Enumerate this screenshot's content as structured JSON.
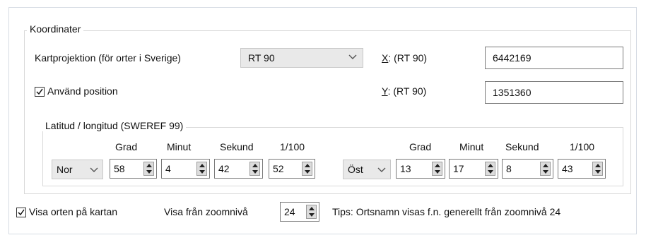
{
  "coordinates": {
    "legend": "Koordinater",
    "projection_label": "Kartprojektion (för orter i Sverige)",
    "projection_value": "RT 90",
    "x_label_key": "X",
    "x_label_rest": ": (RT 90)",
    "x_value": "6442169",
    "y_label_key": "Y",
    "y_label_rest": ": (RT 90)",
    "y_value": "1351360",
    "use_position_label": "Använd position",
    "use_position_checked": true
  },
  "latlon": {
    "legend": "Latitud / longitud (SWEREF 99)",
    "headers": [
      "Grad",
      "Minut",
      "Sekund",
      "1/100"
    ],
    "lat": {
      "direction": "Nor",
      "grad": "58",
      "minut": "4",
      "sekund": "42",
      "hundredths": "52"
    },
    "lon": {
      "direction": "Öst",
      "grad": "13",
      "minut": "17",
      "sekund": "8",
      "hundredths": "43"
    }
  },
  "bottom": {
    "show_on_map_label": "Visa orten på kartan",
    "show_on_map_checked": true,
    "zoom_label": "Visa från zoomnivå",
    "zoom_value": "24",
    "tip": "Tips: Ortsnamn visas f.n. generellt från zoomnivå 24"
  }
}
